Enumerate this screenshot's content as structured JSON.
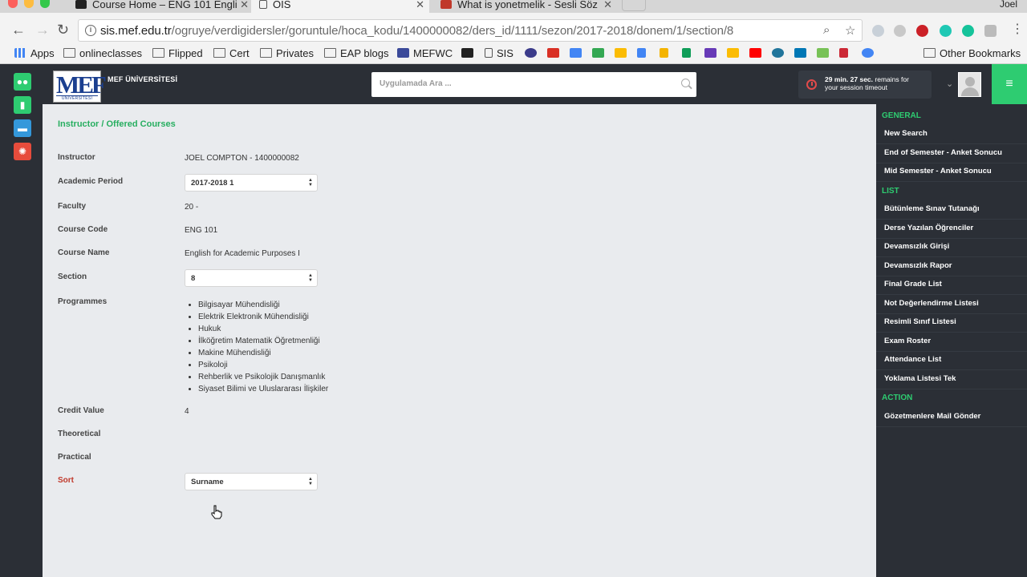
{
  "browser": {
    "tabs": [
      {
        "title": "Course Home – ENG 101 Engli",
        "favicon": "bb-favicon"
      },
      {
        "title": "OIS",
        "favicon": "page-favicon"
      },
      {
        "title": "What is yonetmelik - Sesli Söz",
        "favicon": "sesli-favicon"
      }
    ],
    "user": "Joel",
    "url_host": "sis.mef.edu.tr",
    "url_path": "/ogruye/verdigidersler/goruntule/hoca_kodu/1400000082/ders_id/1111/sezon/2017-2018/donem/1/section/8",
    "bookmarks": [
      "Apps",
      "onlineclasses",
      "Flipped",
      "Cert",
      "Privates",
      "EAP blogs",
      "MEFWC",
      "SIS"
    ],
    "other_bookmarks": "Other Bookmarks"
  },
  "app": {
    "university_name": "MEF ÜNİVERSİTESİ",
    "logo_text": "MEF",
    "logo_sub": "ÜNİVERSİTESİ",
    "search_placeholder": "Uygulamada Ara ...",
    "session_time": "29 min. 27 sec.",
    "session_msg1": "remains for",
    "session_msg2": "your session timeout",
    "accent_color": "#2ecc71"
  },
  "page": {
    "title": "Instructor / Offered Courses",
    "labels": {
      "instructor": "Instructor",
      "academic_period": "Academic Period",
      "faculty": "Faculty",
      "course_code": "Course Code",
      "course_name": "Course Name",
      "section": "Section",
      "programmes": "Programmes",
      "credit_value": "Credit Value",
      "theoretical": "Theoretical",
      "practical": "Practical",
      "sort": "Sort"
    },
    "values": {
      "instructor": "JOEL COMPTON - 1400000082",
      "academic_period": "2017-2018 1",
      "faculty": "20 -",
      "course_code": "ENG 101",
      "course_name": "English for Academic Purposes I",
      "section": "8",
      "credit_value": "4",
      "theoretical": "",
      "practical": "",
      "sort": "Surname"
    },
    "programmes": [
      "Bilgisayar Mühendisliği",
      "Elektrik Elektronik Mühendisliği",
      "Hukuk",
      "İlköğretim Matematik Öğretmenliği",
      "Makine Mühendisliği",
      "Psikoloji",
      "Rehberlik ve Psikolojik Danışmanlık",
      "Siyaset Bilimi ve Uluslararası İlişkiler"
    ]
  },
  "right_panel": {
    "general_title": "GENERAL",
    "general": [
      "New Search",
      "End of Semester - Anket Sonucu",
      "Mid Semester - Anket Sonucu"
    ],
    "list_title": "LIST",
    "list": [
      "Bütünleme Sınav Tutanağı",
      "Derse Yazılan Öğrenciler",
      "Devamsızlık Girişi",
      "Devamsızlık Rapor",
      "Final Grade List",
      "Not Değerlendirme Listesi",
      "Resimli Sınıf Listesi",
      "Exam Roster",
      "Attendance List",
      "Yoklama Listesi Tek"
    ],
    "action_title": "ACTION",
    "action": [
      "Gözetmenlere Mail Gönder"
    ]
  }
}
